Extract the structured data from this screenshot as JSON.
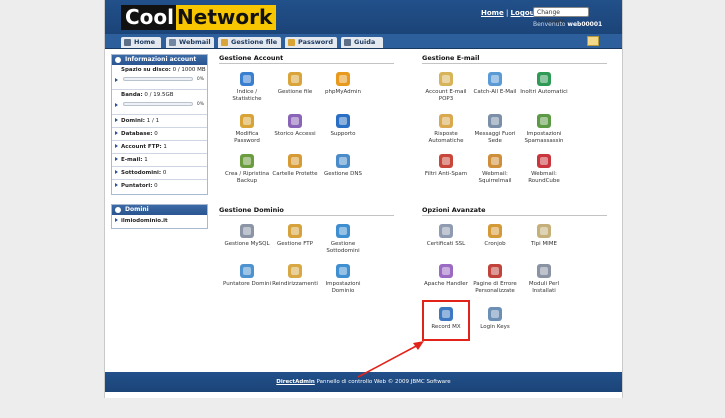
{
  "header": {
    "logo_part1": "Cool",
    "logo_part2": "Network",
    "home_link": "Home",
    "separator": "|",
    "logout_link": "Logout",
    "language_select": "Change language...",
    "welcome_label": "Benvenuto",
    "username": "web00001"
  },
  "nav": {
    "tabs": [
      {
        "label": "Home",
        "icon": "home-icon"
      },
      {
        "label": "Webmail",
        "icon": "mail-icon"
      },
      {
        "label": "Gestione file",
        "icon": "folder-icon"
      },
      {
        "label": "Password",
        "icon": "key-icon"
      },
      {
        "label": "Guida",
        "icon": "help-icon"
      }
    ]
  },
  "sidebar": {
    "account_title": "Informazioni account",
    "disk_label": "Spazio su disco:",
    "disk_value": "0 / 1000 MB",
    "disk_pct": "0%",
    "bandwidth_label": "Banda:",
    "bandwidth_value": "0 / 19.5GB",
    "bandwidth_pct": "0%",
    "stats": [
      {
        "label": "Domini:",
        "value": "1 / 1"
      },
      {
        "label": "Database:",
        "value": "0"
      },
      {
        "label": "Account FTP:",
        "value": "1"
      },
      {
        "label": "E-mail:",
        "value": "1"
      },
      {
        "label": "Sottodomini:",
        "value": "0"
      },
      {
        "label": "Puntatori:",
        "value": "0"
      }
    ],
    "domains_title": "Domini",
    "domain": "ilmiodominio.it"
  },
  "sections": {
    "account": {
      "title": "Gestione Account",
      "items": [
        {
          "label": "Indice / Statistiche",
          "color": "#3b7fd0",
          "icon": "stats-icon"
        },
        {
          "label": "Gestione file",
          "color": "#d9a53a",
          "icon": "folder-icon"
        },
        {
          "label": "phpMyAdmin",
          "color": "#e89a1e",
          "icon": "phpmyadmin-icon"
        },
        {
          "label": "Modifica Password",
          "color": "#d8a437",
          "icon": "lock-icon"
        },
        {
          "label": "Storico Accessi",
          "color": "#8a64b7",
          "icon": "log-icon"
        },
        {
          "label": "Supporto",
          "color": "#2a6fc4",
          "icon": "support-icon"
        },
        {
          "label": "Crea / Ripristina Backup",
          "color": "#6b9c3f",
          "icon": "backup-icon"
        },
        {
          "label": "Cartelle Protette",
          "color": "#d79b35",
          "icon": "protected-folder-icon"
        },
        {
          "label": "Gestione DNS",
          "color": "#4a8cc9",
          "icon": "dns-icon"
        }
      ]
    },
    "email": {
      "title": "Gestione E-mail",
      "items": [
        {
          "label": "Account E-mail POP3",
          "color": "#d7b45a",
          "icon": "envelope-icon"
        },
        {
          "label": "Catch-All E-Mail",
          "color": "#5b9bd5",
          "icon": "catch-all-icon"
        },
        {
          "label": "Inoltri Automatici",
          "color": "#2f9a55",
          "icon": "forward-icon"
        },
        {
          "label": "Risposte Automatiche",
          "color": "#d9a84f",
          "icon": "autoreply-icon"
        },
        {
          "label": "Messaggi Fuori Sede",
          "color": "#7b8fa8",
          "icon": "vacation-icon"
        },
        {
          "label": "Impostazioni Spamassassin",
          "color": "#5c9a45",
          "icon": "spam-settings-icon"
        },
        {
          "label": "Filtri Anti-Spam",
          "color": "#c9473a",
          "icon": "spam-filter-icon"
        },
        {
          "label": "Webmail: Squirrelmail",
          "color": "#cf8f3a",
          "icon": "squirrelmail-icon"
        },
        {
          "label": "Webmail: RoundCube",
          "color": "#c9363d",
          "icon": "roundcube-icon"
        }
      ]
    },
    "domain": {
      "title": "Gestione Dominio",
      "items": [
        {
          "label": "Gestione MySQL",
          "color": "#8b95a6",
          "icon": "mysql-icon"
        },
        {
          "label": "Gestione FTP",
          "color": "#d6a23b",
          "icon": "ftp-icon"
        },
        {
          "label": "Gestione Sottodomini",
          "color": "#3e8ed0",
          "icon": "subdomain-icon"
        },
        {
          "label": "Puntatore Domini",
          "color": "#4e93cf",
          "icon": "domain-pointer-icon"
        },
        {
          "label": "Reindirizzamenti",
          "color": "#d8a845",
          "icon": "redirect-icon"
        },
        {
          "label": "Impostazioni Dominio",
          "color": "#3f8fd1",
          "icon": "domain-settings-icon"
        }
      ]
    },
    "advanced": {
      "title": "Opzioni Avanzate",
      "items": [
        {
          "label": "Certificati SSL",
          "color": "#8f9bb0",
          "icon": "ssl-icon"
        },
        {
          "label": "Cronjob",
          "color": "#d59a38",
          "icon": "clock-icon"
        },
        {
          "label": "Tipi MIME",
          "color": "#c5b07a",
          "icon": "mime-icon"
        },
        {
          "label": "Apache Handler",
          "color": "#9b6ac3",
          "icon": "apache-icon"
        },
        {
          "label": "Pagine di Errore Personalizzate",
          "color": "#c0443c",
          "icon": "error-page-icon"
        },
        {
          "label": "Moduli Perl Installati",
          "color": "#8a93a3",
          "icon": "perl-icon"
        },
        {
          "label": "Record MX",
          "color": "#3c79c2",
          "icon": "mx-record-icon"
        },
        {
          "label": "Login Keys",
          "color": "#6c8fb6",
          "icon": "login-keys-icon"
        }
      ]
    }
  },
  "footer": {
    "link": "DirectAdmin",
    "text": " Pannello di controllo Web © 2009 JBMC Software"
  },
  "colors": {
    "header_blue": "#1b4478",
    "logo_yellow": "#f7c600",
    "highlight_red": "#e2231a"
  }
}
